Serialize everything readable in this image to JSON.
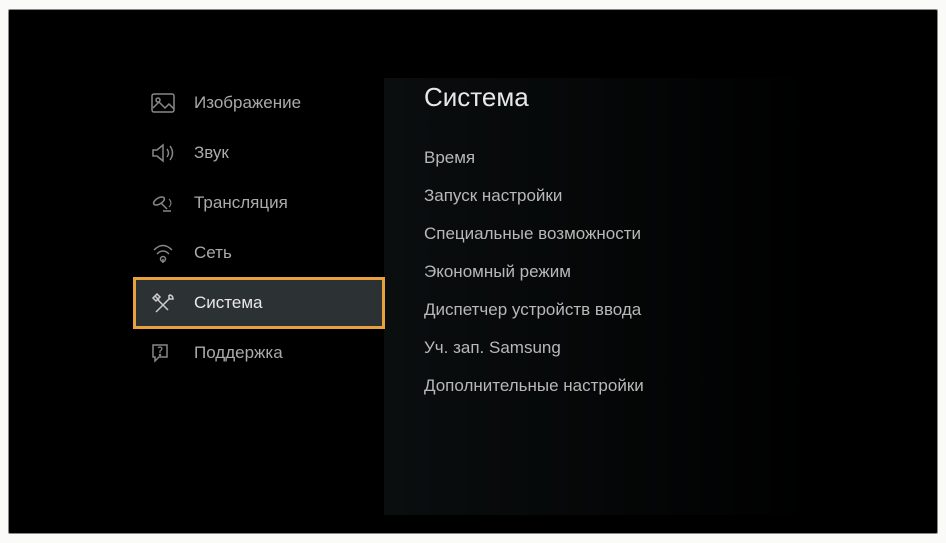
{
  "sidebar": {
    "items": [
      {
        "label": "Изображение"
      },
      {
        "label": "Звук"
      },
      {
        "label": "Трансляция"
      },
      {
        "label": "Сеть"
      },
      {
        "label": "Система"
      },
      {
        "label": "Поддержка"
      }
    ]
  },
  "content": {
    "title": "Система",
    "items": [
      "Время",
      "Запуск настройки",
      "Специальные возможности",
      "Экономный режим",
      "Диспетчер устройств ввода",
      "Уч. зап. Samsung",
      "Дополнительные настройки"
    ]
  }
}
